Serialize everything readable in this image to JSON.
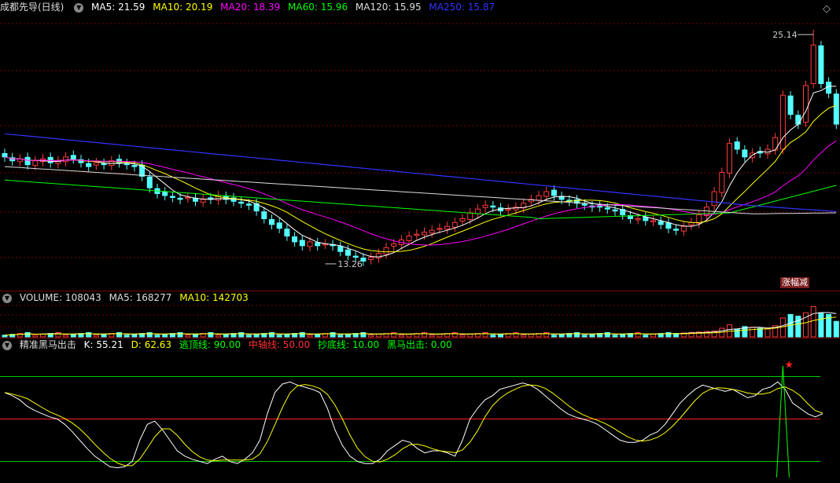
{
  "main": {
    "title": "成都先导(日线)",
    "ma": [
      {
        "label": "MA5: 21.59",
        "color": "#ffffff"
      },
      {
        "label": "MA10: 20.19",
        "color": "#ffff00"
      },
      {
        "label": "MA20: 18.39",
        "color": "#ff00ff"
      },
      {
        "label": "MA60: 15.96",
        "color": "#00ff00"
      },
      {
        "label": "MA120: 15.95",
        "color": "#dddddd"
      },
      {
        "label": "MA250: 15.87",
        "color": "#3333ff"
      }
    ],
    "high_label": "25.14",
    "low_label": "13.26",
    "badge": "涨幅减"
  },
  "volume": {
    "title": "VOLUME: 108043",
    "ma5": "MA5: 168277",
    "ma10": "MA10: 142703"
  },
  "indicator": {
    "title": "精准黑马出击",
    "items": [
      {
        "label": "K: 55.21",
        "color": "#ffffff"
      },
      {
        "label": "D: 62.63",
        "color": "#ffff00"
      },
      {
        "label": "逃顶线: 90.00",
        "color": "#00ff00"
      },
      {
        "label": "中轴线: 50.00",
        "color": "#ff3030"
      },
      {
        "label": "抄底线: 10.00",
        "color": "#00ff00"
      },
      {
        "label": "黑马出击: 0.00",
        "color": "#00ff00"
      }
    ]
  },
  "colors": {
    "up": "#ff3b3b",
    "down": "#54ffff",
    "grid": "#7a0000"
  },
  "chart_data": {
    "type": "candlestick",
    "close_series_approx": [
      18.8,
      18.6,
      18.7,
      18.4,
      18.6,
      18.7,
      18.5,
      18.6,
      18.8,
      18.7,
      18.5,
      18.3,
      18.5,
      18.4,
      18.6,
      18.5,
      18.4,
      18.3,
      17.8,
      17.2,
      16.9,
      16.8,
      16.7,
      16.6,
      16.7,
      16.5,
      16.6,
      16.6,
      16.8,
      16.6,
      16.5,
      16.4,
      16.3,
      16.0,
      15.6,
      15.3,
      15.1,
      14.7,
      14.4,
      14.2,
      14.4,
      14.2,
      14.3,
      14.2,
      13.9,
      13.7,
      13.6,
      13.4,
      13.6,
      13.8,
      14.1,
      14.3,
      14.5,
      14.7,
      14.8,
      14.9,
      15.0,
      15.1,
      15.2,
      15.4,
      15.6,
      15.9,
      16.1,
      16.3,
      16.2,
      16.0,
      16.1,
      16.2,
      16.4,
      16.6,
      16.8,
      17.0,
      16.8,
      16.6,
      16.5,
      16.4,
      16.3,
      16.2,
      16.2,
      16.1,
      16.0,
      15.8,
      15.6,
      15.6,
      15.5,
      15.5,
      15.3,
      15.1,
      15.0,
      15.2,
      15.4,
      15.8,
      16.2,
      17.0,
      18.0,
      19.5,
      19.2,
      18.8,
      19.0,
      19.0,
      19.2,
      19.8,
      22.0,
      21.0,
      20.5,
      22.5,
      24.6,
      22.6,
      22.1,
      20.5
    ]
  }
}
